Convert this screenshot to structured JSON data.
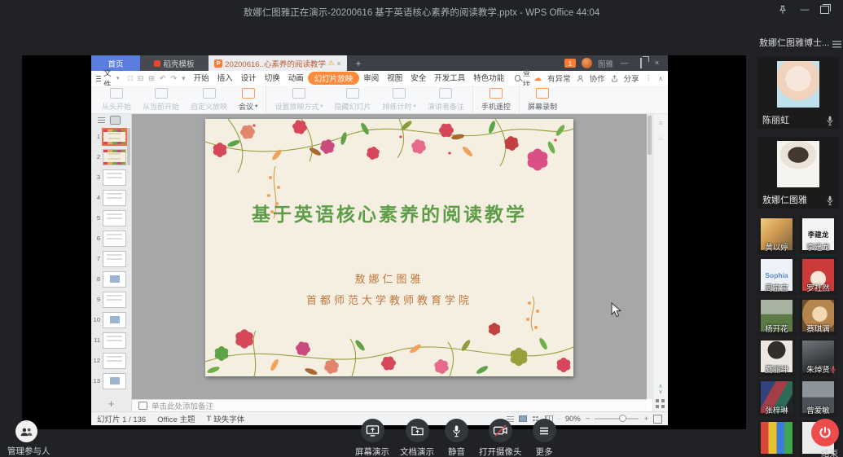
{
  "meeting": {
    "title": "敖娜仁图雅正在演示-20200616 基于英语核心素养的阅读教学.pptx - WPS Office 44:04",
    "sidebar_title": "敖娜仁图雅博士...",
    "manage_label": "管理参与人",
    "end_label": "结束",
    "colors": {
      "end_red": "#ee4c4c",
      "muted_mic": "#e05050"
    },
    "toolbar_buttons": [
      {
        "label": "屏幕演示",
        "icon": "screen-share-icon"
      },
      {
        "label": "文档演示",
        "icon": "doc-share-icon"
      },
      {
        "label": "静音",
        "icon": "mic-icon"
      },
      {
        "label": "打开摄像头",
        "icon": "camera-off-icon"
      },
      {
        "label": "更多",
        "icon": "more-icon"
      }
    ],
    "participants_large": [
      {
        "name": "陈丽虹",
        "avatar_bg": "radial-gradient(circle at 50% 38%, #f6e7da 0 35%, #f0d2bd 36% 60%, #bfe2ec 61% 100%)"
      },
      {
        "name": "敖娜仁图雅",
        "avatar_bg": "radial-gradient(ellipse 60% 42% at 50% 30%, #44372f 0 40%, #eae3da 41% 72%, #f6f4f1 73%)"
      }
    ],
    "participants_small": [
      {
        "name": "黄以婷",
        "avatar_bg": "linear-gradient(135deg,#f0cf7e 0%,#cf9a52 45%,#7a6340 100%)"
      },
      {
        "name": "李建龙",
        "avatar_bg": "#f4f4f4",
        "avatar_text": "李建龙",
        "avatar_text_color": "#1a1a1a"
      },
      {
        "name": "周宝宝",
        "avatar_bg": "#eef2f8",
        "avatar_text": "Sophia",
        "avatar_text_color": "#5a8ad6"
      },
      {
        "name": "罗社然",
        "avatar_bg": "radial-gradient(circle at 50% 62%, #f6e8d8 0 30%, #cc3a3a 31% 100%)"
      },
      {
        "name": "杨开花",
        "avatar_bg": "linear-gradient(180deg,#a8b2a0 0 45%,#5c7a46 46%)"
      },
      {
        "name": "蔡琪满",
        "avatar_bg": "radial-gradient(circle at 55% 45%, #f2d8b0 0 30%, #b5854e 31% 70%, #6e4e30 71%)"
      },
      {
        "name": "夏丽坤",
        "avatar_bg": "radial-gradient(circle at 50% 30%, #332e2b 0 32%, #ece7e1 33%)"
      },
      {
        "name": "朱焯贤",
        "avatar_bg": "linear-gradient(160deg,#70767c 0%,#33373b 70%)",
        "muted": true
      },
      {
        "name": "张梓琳",
        "avatar_bg": "linear-gradient(120deg,#31427c 0 30%,#a33f46 31% 55%,#2e6a58 56% 78%,#20242c 79%)"
      },
      {
        "name": "曾爱敏",
        "avatar_bg": "linear-gradient(180deg,#8d939b 0 50%,#4c5158 51%)"
      }
    ],
    "participants_partial": [
      {
        "avatar_bg": "linear-gradient(90deg,#d8483a 0 25%,#e6c22e 25% 50%,#3d7bd8 50% 75%,#3fa84e 75%)"
      },
      {
        "avatar_bg": "#ececec"
      }
    ]
  },
  "wps": {
    "tab_bar": {
      "home_label": "首页",
      "docer_label": "稻壳模板",
      "doc_label": "20200616..心素养的阅读教学",
      "badge": "1",
      "account": "图雅"
    },
    "menu_bar": {
      "file_label": "文件",
      "find_label": "查找",
      "items": [
        {
          "label": "开始"
        },
        {
          "label": "插入"
        },
        {
          "label": "设计"
        },
        {
          "label": "切换"
        },
        {
          "label": "动画"
        },
        {
          "label": "幻灯片放映",
          "cls": "active"
        },
        {
          "label": "审阅"
        },
        {
          "label": "视图"
        },
        {
          "label": "安全"
        },
        {
          "label": "开发工具"
        },
        {
          "label": "特色功能"
        }
      ],
      "right": [
        {
          "label": "有异常"
        },
        {
          "label": "协作"
        },
        {
          "label": "分享"
        }
      ]
    },
    "ribbon": [
      {
        "label": "从头开始",
        "cls": "dis"
      },
      {
        "label": "从当前开始",
        "cls": "dis"
      },
      {
        "label": "自定义放映",
        "cls": "dis"
      },
      {
        "label": "会议",
        "cls": "accent",
        "caret": true
      },
      {
        "label": "设置放映方式",
        "cls": "dis div",
        "caret": true
      },
      {
        "label": "隐藏幻灯片",
        "cls": "dis"
      },
      {
        "label": "排练计时",
        "cls": "dis",
        "caret": true
      },
      {
        "label": "演讲者备注",
        "cls": "dis"
      },
      {
        "label": "手机遥控",
        "cls": "accent div"
      },
      {
        "label": "屏幕录制",
        "cls": "accent div"
      }
    ],
    "slide": {
      "title": "基于英语核心素养的阅读教学",
      "author": "敖娜仁图雅",
      "affiliation": "首都师范大学教师教育学院",
      "title_color": "#5e9c49",
      "text_color": "#c1763d",
      "bg_color": "#f4efe1"
    },
    "notes_placeholder": "单击此处添加备注",
    "status_bar": {
      "slide_no": "幻灯片 1 / 136",
      "theme": "Office 主题",
      "font_warn": "缺失字体",
      "zoom": "90%"
    },
    "thumbs": [
      {
        "n": "1",
        "cls": "sel warm"
      },
      {
        "n": "2",
        "cls": "warm"
      },
      {
        "n": "3"
      },
      {
        "n": "4"
      },
      {
        "n": "5"
      },
      {
        "n": "6"
      },
      {
        "n": "7"
      },
      {
        "n": "8",
        "cls": "pic"
      },
      {
        "n": "9"
      },
      {
        "n": "10",
        "cls": "pic"
      },
      {
        "n": "11"
      },
      {
        "n": "12"
      },
      {
        "n": "13",
        "cls": "pic"
      }
    ]
  },
  "glyphs": {
    "plus": "+",
    "close": "×",
    "warn": "⚠",
    "minimize": "—",
    "dots": "⋮",
    "collapse": "∧",
    "undo": "↶",
    "redo": "↷",
    "save": "□",
    "print": "⊟",
    "export": "⊞",
    "cloud": "☁",
    "caret": "▾",
    "dot": "·",
    "minus": "−",
    "zoom_plus": "+",
    "strip_up": "∧",
    "strip_down": "∨",
    "font_t": "T"
  }
}
